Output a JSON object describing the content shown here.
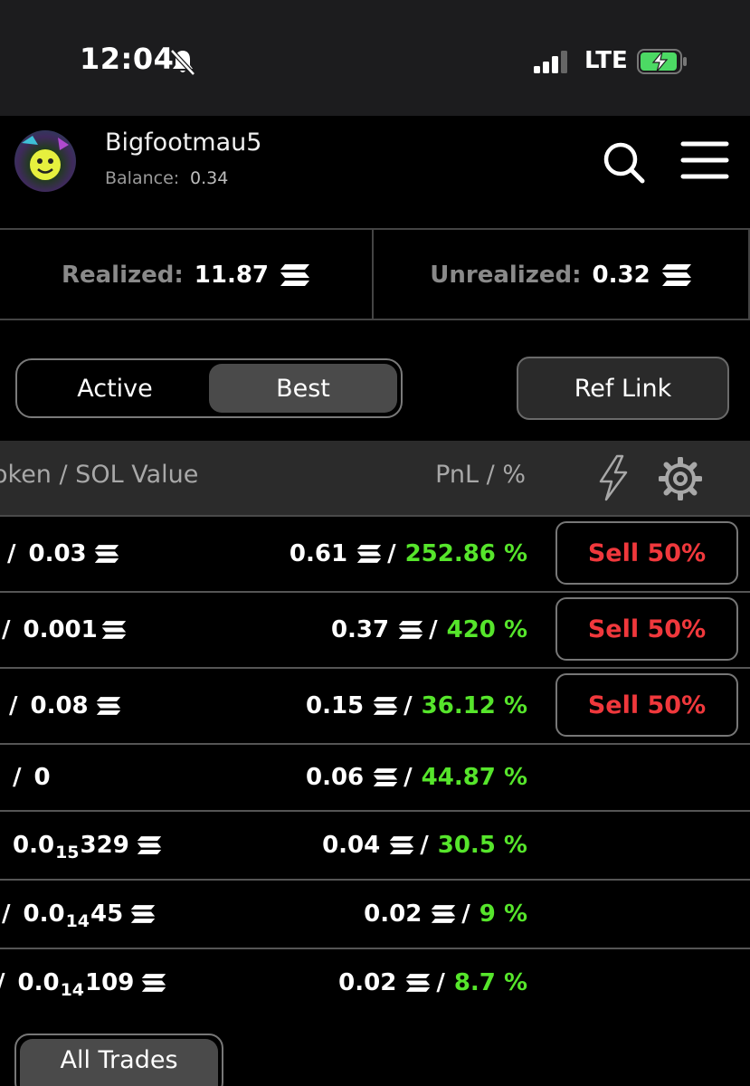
{
  "status_bar": {
    "time": "12:04",
    "network": "LTE"
  },
  "header": {
    "username": "Bigfootmau5",
    "balance_label": "Balance:",
    "balance_value": "0.34"
  },
  "stats": {
    "realized_label": "Realized:",
    "realized_value": "11.87",
    "unrealized_label": "Unrealized:",
    "unrealized_value": "0.32"
  },
  "toggle": {
    "active_label": "Active",
    "best_label": "Best",
    "selected": "Best"
  },
  "ref_link_label": "Ref Link",
  "table": {
    "col_token": "oken / SOL Value",
    "col_pnl": "PnL / %",
    "rows": [
      {
        "prefix": "/",
        "sol_value": "0.03",
        "pnl": "0.61",
        "percent": "252.86 %",
        "sell_label": "Sell 50%"
      },
      {
        "prefix": "/",
        "sol_value": "0.001",
        "pnl": "0.37",
        "percent": "420 %",
        "sell_label": "Sell 50%"
      },
      {
        "prefix": "/",
        "sol_value": "0.08",
        "pnl": "0.15",
        "percent": "36.12 %",
        "sell_label": "Sell 50%"
      },
      {
        "prefix": "/",
        "sol_value": "0",
        "pnl": "0.06",
        "percent": "44.87 %"
      },
      {
        "prefix": "",
        "sol_pre": "0.0",
        "sol_sub": "15",
        "sol_post": "329",
        "pnl": "0.04",
        "percent": "30.5 %"
      },
      {
        "prefix": "/",
        "sol_pre": "0.0",
        "sol_sub": "14",
        "sol_post": "45",
        "pnl": "0.02",
        "percent": "9 %"
      },
      {
        "prefix": "/",
        "sol_pre": "0.0",
        "sol_sub": "14",
        "sol_post": "109",
        "pnl": "0.02",
        "percent": "8.7 %"
      }
    ]
  },
  "all_trades_label": "All Trades",
  "colors": {
    "positive": "#56e52b",
    "sell": "#f0383c",
    "background": "#000000",
    "panel": "#2b2b2b"
  },
  "icons": [
    "bell-slash-icon",
    "signal-icon",
    "battery-charging-icon",
    "search-icon",
    "menu-icon",
    "solana-icon",
    "lightning-icon",
    "gear-icon"
  ]
}
